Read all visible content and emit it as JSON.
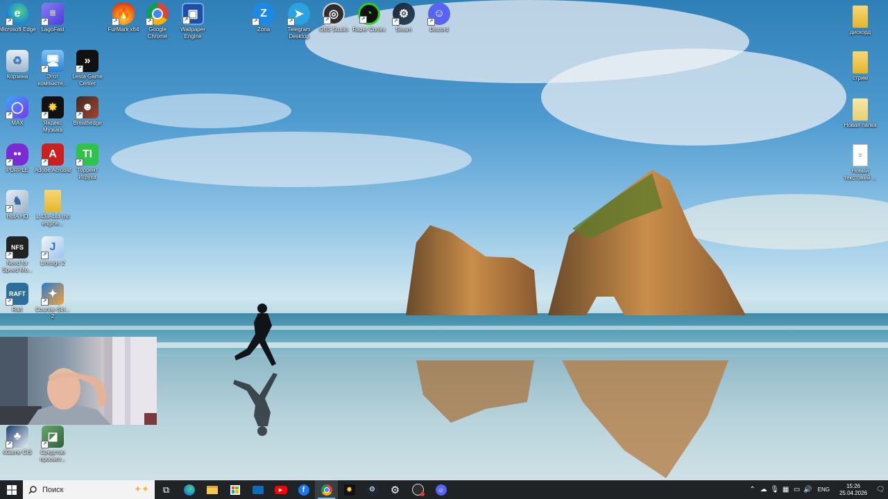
{
  "desktop": {
    "icons": [
      {
        "id": "edge",
        "label": "Microsoft Edge",
        "icon": "edge-icon",
        "color": "#1b8fd6"
      },
      {
        "id": "lagofast",
        "label": "LagoFast",
        "icon": "lagofast-icon",
        "color": "#5b4de8"
      },
      {
        "id": "furmark",
        "label": "FurMark x64",
        "icon": "flame-icon",
        "color": "#e55a12"
      },
      {
        "id": "chrome",
        "label": "Google Chrome",
        "icon": "chrome-icon",
        "color": "#db4437"
      },
      {
        "id": "wallpaper-engine",
        "label": "Wallpaper Engine",
        "icon": "wallpaper-engine-icon",
        "color": "#2a6fd1"
      },
      {
        "id": "zona",
        "label": "Zona",
        "icon": "zona-icon",
        "color": "#1e88e5"
      },
      {
        "id": "telegram",
        "label": "Telegram Desktop",
        "icon": "telegram-icon",
        "color": "#2aa3e0"
      },
      {
        "id": "obs",
        "label": "OBS Studio",
        "icon": "obs-icon",
        "color": "#302e31"
      },
      {
        "id": "razer",
        "label": "Razer Cortex",
        "icon": "razer-icon",
        "color": "#2bd121"
      },
      {
        "id": "steam",
        "label": "Steam",
        "icon": "steam-icon",
        "color": "#1b2838"
      },
      {
        "id": "discord",
        "label": "Discord",
        "icon": "discord-icon",
        "color": "#5865f2"
      },
      {
        "id": "recycle",
        "label": "Корзина",
        "icon": "recycle-bin-icon",
        "color": "#8aa6bf"
      },
      {
        "id": "this-pc",
        "label": "Этот компьюте...",
        "icon": "computer-icon",
        "color": "#3b8ed8"
      },
      {
        "id": "lesta",
        "label": "Lesta Game Center",
        "icon": "lesta-icon",
        "color": "#111111"
      },
      {
        "id": "max",
        "label": "MAX",
        "icon": "max-icon",
        "color": "#6b3cf0"
      },
      {
        "id": "yandex-music",
        "label": "Яндекс Музыка",
        "icon": "yandex-music-icon",
        "color": "#111111"
      },
      {
        "id": "breathedge",
        "label": "Breathedge",
        "icon": "breathedge-icon",
        "color": "#8a2a1f"
      },
      {
        "id": "purple",
        "label": "PURPLE",
        "icon": "purple-icon",
        "color": "#7a2bd4"
      },
      {
        "id": "acrobat",
        "label": "Adobe Acrobat",
        "icon": "acrobat-icon",
        "color": "#cc1f1f"
      },
      {
        "id": "torrent",
        "label": "Торрент Игруха",
        "icon": "torrent-icon",
        "color": "#2fc34a"
      },
      {
        "id": "hota",
        "label": "HotA HD",
        "icon": "hota-icon",
        "color": "#c9d8e6"
      },
      {
        "id": "folder-1",
        "label": "1.43a-4x4 (no engine...",
        "icon": "folder-icon",
        "color": "#f2c94c"
      },
      {
        "id": "nfs",
        "label": "Need for Speed Mo...",
        "icon": "nfs-icon",
        "color": "#222222"
      },
      {
        "id": "lineage",
        "label": "Lineage 2",
        "icon": "lineage-icon",
        "color": "#2f6fd1"
      },
      {
        "id": "raft",
        "label": "Raft",
        "icon": "raft-icon",
        "color": "#2d6e9a"
      },
      {
        "id": "cs",
        "label": "Counter-Stri... 2",
        "icon": "cs-icon",
        "color": "#1f5fa8"
      },
      {
        "id": "4game",
        "label": "4Game CIS",
        "icon": "4game-icon",
        "color": "#1d3d6b"
      },
      {
        "id": "tool",
        "label": "Средство просмот...",
        "icon": "viewer-icon",
        "color": "#3a7a4a"
      },
      {
        "id": "discord-folder",
        "label": "дискорд",
        "icon": "folder-icon",
        "color": "#f2c94c"
      },
      {
        "id": "stream",
        "label": "стрим",
        "icon": "folder-icon",
        "color": "#f2c94c"
      },
      {
        "id": "new-folder",
        "label": "Новая папка",
        "icon": "folder-icon",
        "color": "#f2c94c"
      },
      {
        "id": "new-text",
        "label": "Новый текстовый ...",
        "icon": "text-document-icon",
        "color": "#ffffff"
      }
    ]
  },
  "taskbar": {
    "search_placeholder": "Поиск",
    "apps": [
      {
        "id": "task-view",
        "icon": "task-view-icon"
      },
      {
        "id": "edge",
        "icon": "edge-icon"
      },
      {
        "id": "explorer",
        "icon": "file-explorer-icon"
      },
      {
        "id": "store",
        "icon": "store-icon"
      },
      {
        "id": "mail",
        "icon": "mail-icon"
      },
      {
        "id": "youtube",
        "icon": "youtube-icon"
      },
      {
        "id": "facebook",
        "icon": "facebook-icon"
      },
      {
        "id": "chrome",
        "icon": "chrome-icon"
      },
      {
        "id": "yandex-music",
        "icon": "yandex-music-icon"
      },
      {
        "id": "steam",
        "icon": "steam-icon"
      },
      {
        "id": "settings",
        "icon": "gear-icon"
      },
      {
        "id": "obs",
        "icon": "obs-icon"
      },
      {
        "id": "discord",
        "icon": "discord-icon"
      }
    ],
    "tray": {
      "language": "ENG",
      "time": "15:26",
      "date": "25.04.2026"
    }
  }
}
